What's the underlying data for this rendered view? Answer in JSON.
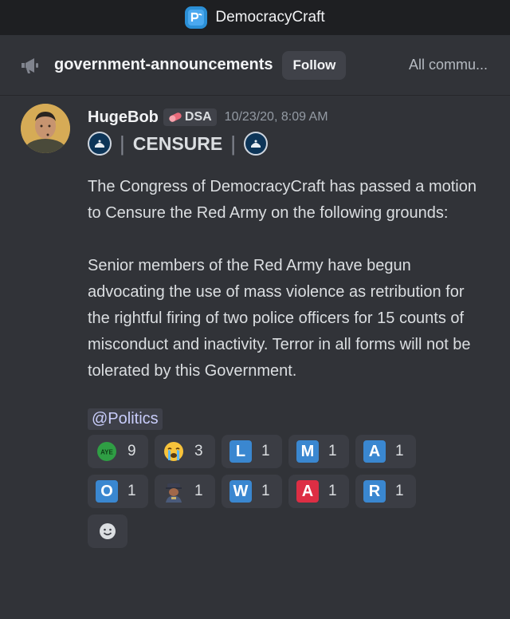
{
  "titlebar": {
    "server_name": "DemocracyCraft",
    "server_icon": "democracycraft-logo"
  },
  "channel": {
    "name": "government-announcements",
    "follow_label": "Follow",
    "all_communities_label": "All commu..."
  },
  "message": {
    "author": "HugeBob",
    "tag": "DSA",
    "timestamp": "10/23/20, 8:09 AM",
    "heading": "CENSURE",
    "paragraph1": "The Congress of DemocracyCraft has passed a motion to Censure the Red Army on the following grounds:",
    "paragraph2": "Senior members of the Red Army have begun advocating the use of mass violence as retribution for the rightful firing of two police officers for 15 counts of misconduct and inactivity. Terror in all forms will not be tolerated by this Government.",
    "mention": "@Politics"
  },
  "reactions": [
    {
      "emoji": "aye",
      "count": "9"
    },
    {
      "emoji": "crying-face",
      "count": "3"
    },
    {
      "emoji": "L",
      "count": "1"
    },
    {
      "emoji": "M",
      "count": "1"
    },
    {
      "emoji": "A",
      "count": "1"
    },
    {
      "emoji": "O",
      "count": "1"
    },
    {
      "emoji": "soldier",
      "count": "1"
    },
    {
      "emoji": "W",
      "count": "1"
    },
    {
      "emoji": "A-red",
      "count": "1"
    },
    {
      "emoji": "R",
      "count": "1"
    }
  ],
  "aye_label": "AYE",
  "letters": {
    "l": "L",
    "m": "M",
    "a": "A",
    "o": "O",
    "w": "W",
    "a_red": "A",
    "r": "R"
  },
  "colors": {
    "background": "#313338",
    "titlebar": "#1e1f22",
    "letter_blue": "#3a87d0",
    "letter_red": "#dd2e44",
    "mention_text": "#c9cdfb"
  }
}
